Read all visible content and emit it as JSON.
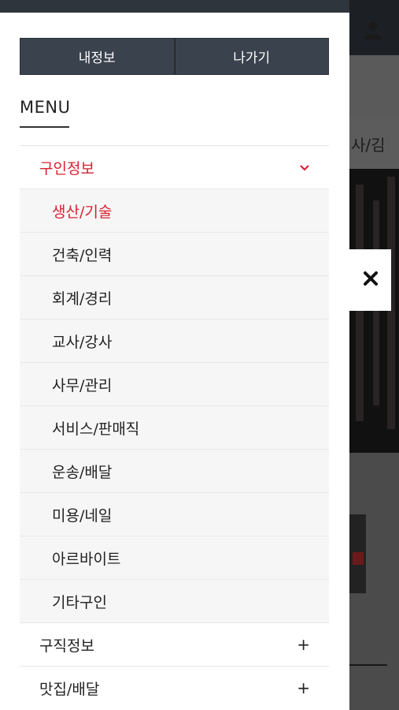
{
  "drawer": {
    "my_info_label": "내정보",
    "logout_label": "나가기",
    "menu_title": "MENU"
  },
  "menu": {
    "categories": [
      {
        "label": "구인정보",
        "expanded": true,
        "subitems": [
          {
            "label": "생산/기술",
            "active": true
          },
          {
            "label": "건축/인력"
          },
          {
            "label": "회계/경리"
          },
          {
            "label": "교사/강사"
          },
          {
            "label": "사무/관리"
          },
          {
            "label": "서비스/판매직"
          },
          {
            "label": "운송/배달"
          },
          {
            "label": "미용/네일"
          },
          {
            "label": "아르바이트"
          },
          {
            "label": "기타구인"
          }
        ]
      },
      {
        "label": "구직정보",
        "expanded": false,
        "indicator": "+"
      },
      {
        "label": "맛집/배달",
        "expanded": false,
        "indicator": "+"
      }
    ]
  },
  "background": {
    "tab_text": "사/김"
  },
  "colors": {
    "accent": "#d62331",
    "button_bg": "#3a434d",
    "topbar": "#2f353c"
  }
}
